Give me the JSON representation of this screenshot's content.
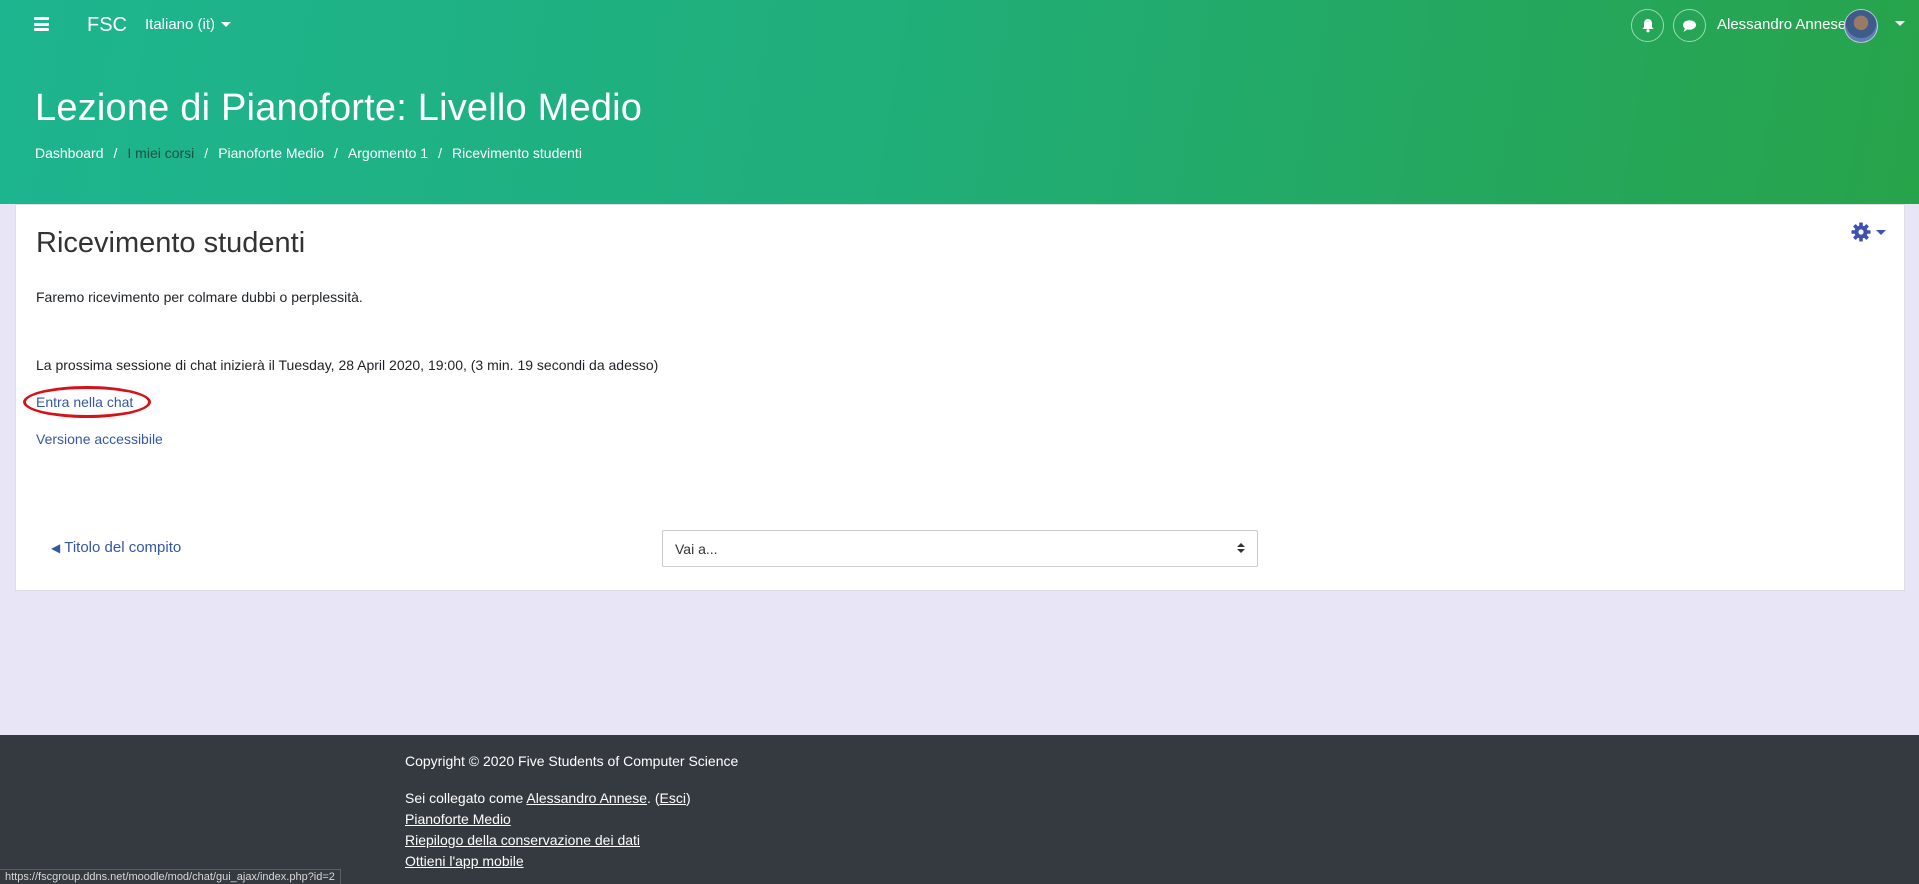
{
  "navbar": {
    "brand": "FSC",
    "language": "Italiano (it)",
    "user_name": "Alessandro Annese",
    "icons": [
      "bell-icon",
      "chat-bubble-icon"
    ]
  },
  "header": {
    "course_title": "Lezione di Pianoforte: Livello Medio",
    "breadcrumb": [
      "Dashboard",
      "I miei corsi",
      "Pianoforte Medio",
      "Argomento 1",
      "Ricevimento studenti"
    ],
    "breadcrumb_separator": "/"
  },
  "main": {
    "title": "Ricevimento studenti",
    "intro": "Faremo ricevimento per colmare dubbi o perplessità.",
    "next_session": "La prossima sessione di chat inizierà il Tuesday, 28 April 2020, 19:00, (3 min. 19 secondi da adesso)",
    "enter_chat_label": "Entra nella chat",
    "accessible_label": "Versione accessibile",
    "prev_activity_label": "Titolo del compito",
    "jump_select_value": "Vai a..."
  },
  "footer": {
    "copyright": "Copyright © 2020 Five Students of Computer Science",
    "logged_in_prefix": "Sei collegato come ",
    "logged_in_user": "Alessandro Annese",
    "logout_label": "Esci",
    "links": [
      "Pianoforte Medio",
      "Riepilogo della conservazione dei dati",
      "Ottieni l'app mobile"
    ]
  },
  "status_bar_url": "https://fscgroup.ddns.net/moodle/mod/chat/gui_ajax/index.php?id=2",
  "colors": {
    "header_gradient_start": "#1db58f",
    "header_gradient_end": "#27a34a",
    "link": "#3557a3",
    "settings_icon": "#3f51b5",
    "highlight": "#d4121a",
    "footer_bg": "#353a40",
    "page_bg": "#e8e6f6"
  }
}
